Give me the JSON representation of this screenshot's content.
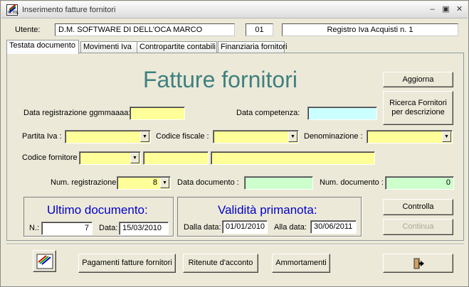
{
  "window": {
    "title": "Inserimento fatture fornitori"
  },
  "header": {
    "user_label": "Utente:",
    "user_name": "D.M. SOFTWARE DI DELL'OCA MARCO",
    "code": "01",
    "register": "Registro Iva Acquisti n. 1"
  },
  "tabs": [
    {
      "label": "Testata documento",
      "active": true
    },
    {
      "label": "Movimenti Iva",
      "active": false
    },
    {
      "label": "Contropartite contabili",
      "active": false
    },
    {
      "label": "Finanziaria fornitori",
      "active": false
    }
  ],
  "main": {
    "title": "Fatture fornitori",
    "labels": {
      "data_registrazione": "Data registrazione ggmmaaaa:",
      "data_competenza": "Data competenza:",
      "partita_iva": "Partita Iva :",
      "codice_fiscale": "Codice fiscale :",
      "denominazione": "Denominazione :",
      "codice_fornitore": "Codice fornitore",
      "num_registrazione": "Num. registrazione:",
      "data_documento": "Data documento :",
      "num_documento": "Num. documento :"
    },
    "values": {
      "data_registrazione": "",
      "data_competenza": "",
      "partita_iva": "",
      "codice_fiscale": "",
      "denominazione": "",
      "codice_fornitore": "",
      "codice_fornitore_2": "",
      "codice_fornitore_3": "",
      "num_registrazione": "8",
      "data_documento": "",
      "num_documento": "0"
    },
    "buttons": {
      "aggiorna": "Aggiorna",
      "ricerca": "Ricerca Fornitori per descrizione",
      "controlla": "Controlla",
      "continua": "Continua"
    },
    "ultimo": {
      "title": "Ultimo documento:",
      "n_label": "N.:",
      "n_value": "7",
      "data_label": "Data:",
      "data_value": "15/03/2010"
    },
    "validita": {
      "title": "Validità primanota:",
      "dalla_label": "Dalla data:",
      "dalla_value": "01/01/2010",
      "alla_label": "Alla data:",
      "alla_value": "30/06/2011"
    }
  },
  "footer": {
    "logo_text": "d.m.",
    "pagamenti": "Pagamenti fatture fornitori",
    "ritenute": "Ritenute d'acconto",
    "ammortamenti": "Ammortamenti"
  },
  "colors": {
    "title_teal": "#3f8080",
    "group_blue": "#0000cc",
    "field_yellow": "#ffff99",
    "field_cyan": "#ccffff",
    "field_green": "#ccffcc"
  }
}
